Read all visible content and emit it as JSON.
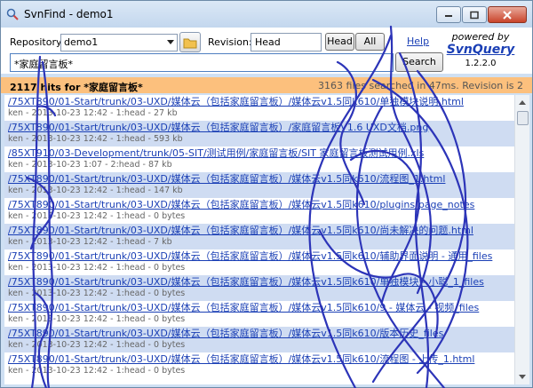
{
  "window": {
    "title": "SvnFind - demo1"
  },
  "toolbar": {
    "repository_label": "Repository:",
    "repository_value": "demo1",
    "revision_label": "Revision:",
    "revision_value": "Head",
    "head_button": "Head",
    "all_button": "All",
    "help_link": "Help",
    "search_query": "*家庭留言板*",
    "search_button": "Search",
    "powered_by": "powered by",
    "brand": "SvnQuery",
    "version": "1.2.2.0"
  },
  "status": {
    "hits": "2117 hits for *家庭留言板*",
    "summary": "3163 files searched in 47ms. Revision is 2"
  },
  "results": [
    {
      "path": "/75XT890/01-Start/trunk/03-UXD/媒体云（包括家庭留言板）/媒体云v1.5同k610/单独模块说明.html",
      "meta": "ken - 2013-10-23 12:42 - 1:head - 27 kb"
    },
    {
      "path": "/75XT890/01-Start/trunk/03-UXD/媒体云（包括家庭留言板）/家庭留言板V1.6 UXD文档.png",
      "meta": "ken - 2013-10-23 12:42 - 1:head - 593 kb"
    },
    {
      "path": "/85XT910/03-Development/trunk/05-SIT/测试用例/家庭留言板/SIT 家庭留言板测试用例.xls",
      "meta": "ken - 2013-10-23 1:07 - 2:head - 87 kb"
    },
    {
      "path": "/75XT890/01-Start/trunk/03-UXD/媒体云（包括家庭留言板）/媒体云v1.5同k610/流程图_1.html",
      "meta": "ken - 2013-10-23 12:42 - 1:head - 147 kb"
    },
    {
      "path": "/75XT890/01-Start/trunk/03-UXD/媒体云（包括家庭留言板）/媒体云v1.5同k610/plugins/page_notes",
      "meta": "ken - 2013-10-23 12:42 - 1:head - 0 bytes"
    },
    {
      "path": "/75XT890/01-Start/trunk/03-UXD/媒体云（包括家庭留言板）/媒体云v1.5同k610/尚未解决的问题.html",
      "meta": "ken - 2013-10-23 12:42 - 1:head - 7 kb"
    },
    {
      "path": "/75XT890/01-Start/trunk/03-UXD/媒体云（包括家庭留言板）/媒体云v1.5同k610/辅助界面说明 - 通用_files",
      "meta": "ken - 2013-10-23 12:42 - 1:head - 0 bytes"
    },
    {
      "path": "/75XT890/01-Start/trunk/03-UXD/媒体云（包括家庭留言板）/媒体云v1.5同k610/单独模块 - 小聪_1_files",
      "meta": "ken - 2013-10-23 12:42 - 1:head - 0 bytes"
    },
    {
      "path": "/75XT890/01-Start/trunk/03-UXD/媒体云（包括家庭留言板）/媒体云v1.5同k610/9 - 媒体云 - 视频_files",
      "meta": "ken - 2013-10-23 12:42 - 1:head - 0 bytes"
    },
    {
      "path": "/75XT890/01-Start/trunk/03-UXD/媒体云（包括家庭留言板）/媒体云v1.5同k610/版本历史_files",
      "meta": "ken - 2013-10-23 12:42 - 1:head - 0 bytes"
    },
    {
      "path": "/75XT890/01-Start/trunk/03-UXD/媒体云（包括家庭留言板）/媒体云v1.5同k610/流程图 - 上传_1.html",
      "meta": "ken - 2013-10-23 12:42 - 1:head - 0 bytes"
    }
  ],
  "colors": {
    "status_bar": "#fcc07d",
    "alt_row": "#cfdcf2",
    "link": "#1a3fb5",
    "scribble": "#2c34b8"
  }
}
